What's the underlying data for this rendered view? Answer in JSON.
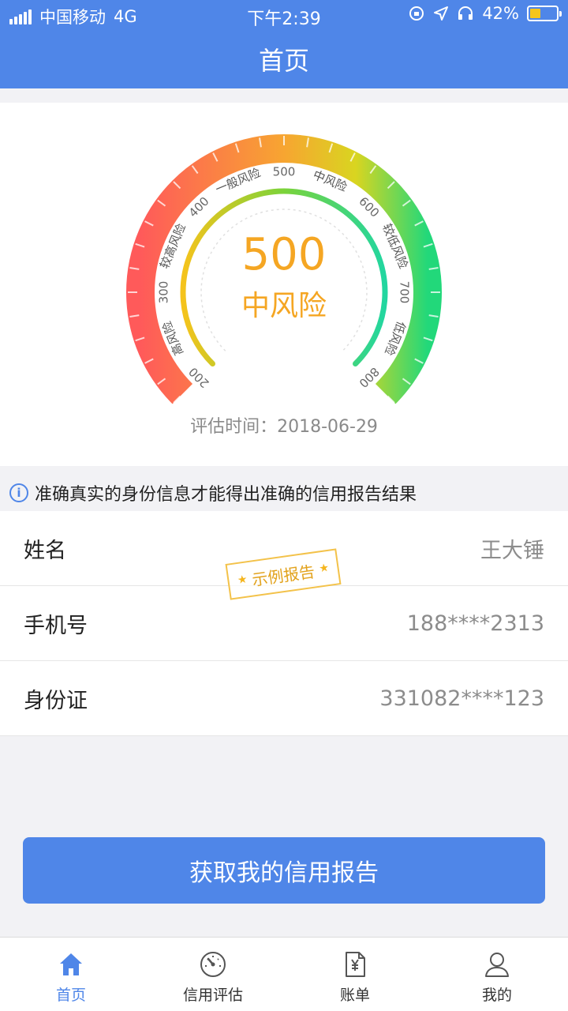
{
  "status_bar": {
    "carrier": "中国移动",
    "network": "4G",
    "time": "下午2:39",
    "battery_percent": "42%",
    "battery_level": 0.42
  },
  "header": {
    "title": "首页"
  },
  "gauge": {
    "score": "500",
    "level": "中风险",
    "min": 200,
    "max": 800,
    "value": 500,
    "ticks": [
      "200",
      "300",
      "400",
      "500",
      "600",
      "700",
      "800"
    ],
    "zones": [
      "高风险",
      "较高风险",
      "一般风险",
      "中风险",
      "较低风险",
      "低风险"
    ],
    "eval_time_label": "评估时间：",
    "eval_time": "2018-06-29"
  },
  "notice": {
    "text": "准确真实的身份信息才能得出准确的信用报告结果"
  },
  "info": {
    "rows": [
      {
        "label": "姓名",
        "value": "王大锤"
      },
      {
        "label": "手机号",
        "value": "188****2313"
      },
      {
        "label": "身份证",
        "value": "331082****123"
      }
    ],
    "stamp": "示例报告"
  },
  "cta": {
    "label": "获取我的信用报告"
  },
  "tabs": [
    {
      "label": "首页",
      "icon": "home-icon",
      "active": true
    },
    {
      "label": "信用评估",
      "icon": "gauge-icon",
      "active": false
    },
    {
      "label": "账单",
      "icon": "bill-icon",
      "active": false
    },
    {
      "label": "我的",
      "icon": "user-icon",
      "active": false
    }
  ],
  "colors": {
    "primary": "#4f86e8",
    "score": "#f5a623",
    "gauge_start": "#ff5a5a",
    "gauge_mid": "#f7a531",
    "gauge_end": "#22d87a"
  }
}
